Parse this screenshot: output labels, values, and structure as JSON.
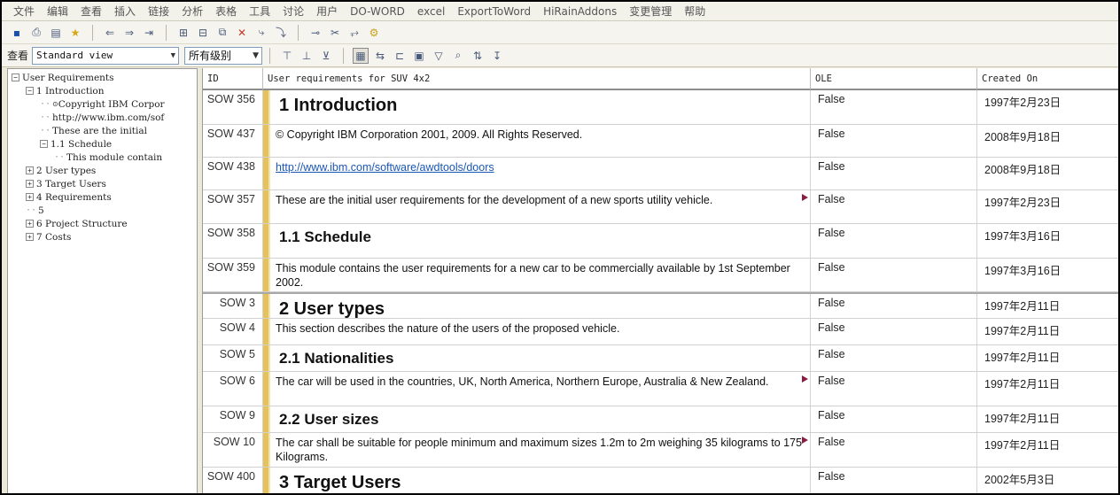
{
  "menu": [
    "文件",
    "编辑",
    "查看",
    "插入",
    "链接",
    "分析",
    "表格",
    "工具",
    "讨论",
    "用户",
    "DO-WORD",
    "excel",
    "ExportToWord",
    "HiRainAddons",
    "变更管理",
    "帮助"
  ],
  "toolbar1": {
    "icons": [
      "save-icon",
      "print-icon",
      "properties-icon",
      "star-icon",
      "promote-icon",
      "demote-icon",
      "indent-icon",
      "insert-object-icon",
      "insert-below-icon",
      "copy-object-icon",
      "delete-object-icon",
      "link-icon",
      "link-tree-icon",
      "split-icon",
      "cut-link-icon",
      "link-start-icon",
      "link-end-icon"
    ]
  },
  "toolbar2": {
    "view_label": "查看",
    "view_select": "Standard view",
    "level_select": "所有级别",
    "icons": [
      "outline-icon",
      "filter-off-icon",
      "sort-icon",
      "layout-icon",
      "link-filter-icon",
      "table-icon",
      "filter-icon",
      "find-icon",
      "sort-asc-icon",
      "sort-az-icon"
    ]
  },
  "tree": [
    {
      "label": "User Requirements",
      "indent": 0,
      "expander": "−"
    },
    {
      "label": "1 Introduction",
      "indent": 1,
      "expander": "−"
    },
    {
      "label": "Copyright IBM Corpor",
      "indent": 2,
      "expander": "",
      "bullet": "⊙"
    },
    {
      "label": "http://www.ibm.com/sof",
      "indent": 2,
      "expander": ""
    },
    {
      "label": "These are the initial",
      "indent": 2,
      "expander": ""
    },
    {
      "label": "1.1 Schedule",
      "indent": 2,
      "expander": "−"
    },
    {
      "label": "This module contain",
      "indent": 3,
      "expander": ""
    },
    {
      "label": "2 User types",
      "indent": 1,
      "expander": "+"
    },
    {
      "label": "3 Target Users",
      "indent": 1,
      "expander": "+"
    },
    {
      "label": "4 Requirements",
      "indent": 1,
      "expander": "+"
    },
    {
      "label": "5",
      "indent": 1,
      "expander": ""
    },
    {
      "label": "6 Project Structure",
      "indent": 1,
      "expander": "+"
    },
    {
      "label": "7 Costs",
      "indent": 1,
      "expander": "+"
    }
  ],
  "columns": {
    "id": "ID",
    "text": "User requirements for SUV 4x2",
    "ole": "OLE",
    "created": "Created On"
  },
  "rows": [
    {
      "id": "SOW 356",
      "text": "1 Introduction",
      "style": "h1",
      "ole": "False",
      "date": "1997年2月23日",
      "h": 39,
      "section": false,
      "flag": false
    },
    {
      "id": "SOW 437",
      "text": "© Copyright IBM Corporation 2001, 2009. All Rights Reserved.",
      "style": "body",
      "ole": "False",
      "date": "2008年9月18日",
      "h": 37,
      "section": false,
      "flag": false
    },
    {
      "id": "SOW 438",
      "text": "http://www.ibm.com/software/awdtools/doors",
      "style": "link",
      "ole": "False",
      "date": "2008年9月18日",
      "h": 37,
      "section": false,
      "flag": false
    },
    {
      "id": "SOW 357",
      "text": "These are the initial user requirements for the development of a new sports utility vehicle.",
      "style": "body",
      "ole": "False",
      "date": "1997年2月23日",
      "h": 38,
      "section": false,
      "flag": true
    },
    {
      "id": "SOW 358",
      "text": "1.1 Schedule",
      "style": "h2",
      "ole": "False",
      "date": "1997年3月16日",
      "h": 39,
      "section": false,
      "flag": false
    },
    {
      "id": "SOW 359",
      "text": "This module contains the user requirements for a new car to be commercially available by 1st September 2002.",
      "style": "body",
      "ole": "False",
      "date": "1997年3月16日",
      "h": 38,
      "section": false,
      "flag": false
    },
    {
      "id": "SOW 3",
      "text": "2 User types",
      "style": "h1",
      "ole": "False",
      "date": "1997年2月11日",
      "h": 30,
      "section": true,
      "flag": false
    },
    {
      "id": "SOW 4",
      "text": "This section describes the nature of the users of the proposed vehicle.",
      "style": "body",
      "ole": "False",
      "date": "1997年2月11日",
      "h": 30,
      "section": false,
      "flag": false
    },
    {
      "id": "SOW 5",
      "text": "2.1 Nationalities",
      "style": "h2",
      "ole": "False",
      "date": "1997年2月11日",
      "h": 30,
      "section": false,
      "flag": false
    },
    {
      "id": "SOW 6",
      "text": "The car will be used in the countries, UK, North America, Northern Europe, Australia & New Zealand.",
      "style": "body",
      "ole": "False",
      "date": "1997年2月11日",
      "h": 39,
      "section": false,
      "flag": true
    },
    {
      "id": "SOW 9",
      "text": "2.2 User sizes",
      "style": "h2",
      "ole": "False",
      "date": "1997年2月11日",
      "h": 30,
      "section": false,
      "flag": false
    },
    {
      "id": "SOW 10",
      "text": "The car shall be suitable for people minimum and maximum sizes 1.2m to 2m weighing 35 kilograms to 175 Kilograms.",
      "style": "body",
      "ole": "False",
      "date": "1997年2月11日",
      "h": 39,
      "section": false,
      "flag": true
    },
    {
      "id": "SOW 400",
      "text": "3 Target Users",
      "style": "h1",
      "ole": "False",
      "date": "2002年5月3日",
      "h": 40,
      "section": false,
      "flag": false
    }
  ]
}
